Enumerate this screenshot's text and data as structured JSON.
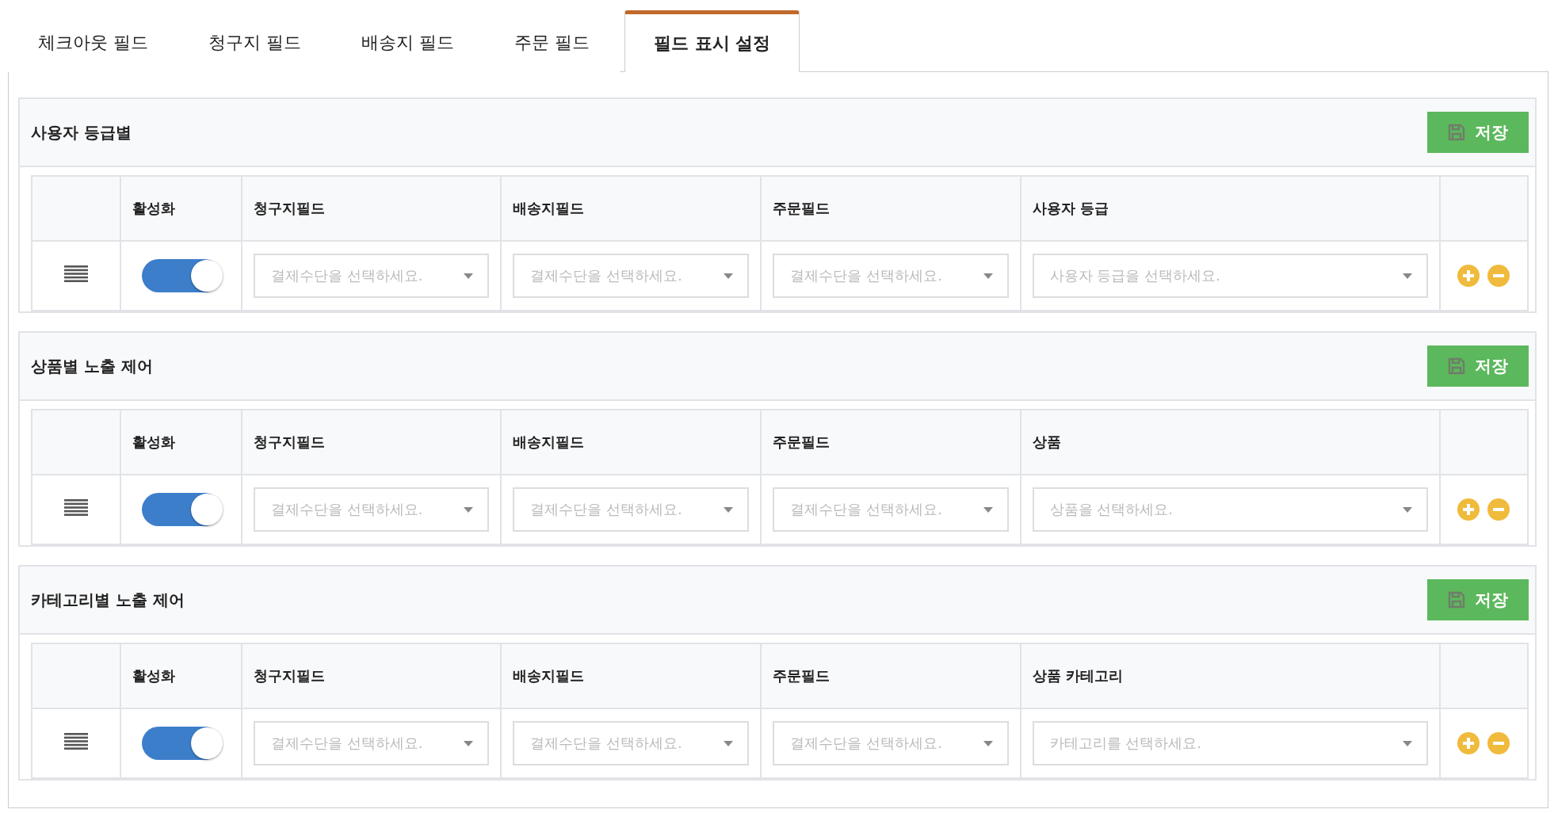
{
  "tabs": [
    {
      "label": "체크아웃 필드",
      "selected": false
    },
    {
      "label": "청구지 필드",
      "selected": false
    },
    {
      "label": "배송지 필드",
      "selected": false
    },
    {
      "label": "주문 필드",
      "selected": false
    },
    {
      "label": "필드 표시 설정",
      "selected": true
    }
  ],
  "sections": [
    {
      "title": "사용자 등급별",
      "save_button": "저장",
      "columns": [
        "활성화",
        "청구지필드",
        "배송지필드",
        "주문필드",
        "사용자 등급"
      ],
      "rows": [
        {
          "on": true,
          "selects": [
            "결제수단을 선택하세요.",
            "결제수단을 선택하세요.",
            "결제수단을 선택하세요.",
            "사용자 등급을 선택하세요."
          ]
        }
      ]
    },
    {
      "title": "상품별 노출 제어",
      "save_button": "저장",
      "columns": [
        "활성화",
        "청구지필드",
        "배송지필드",
        "주문필드",
        "상품"
      ],
      "rows": [
        {
          "on": true,
          "selects": [
            "결제수단을 선택하세요.",
            "결제수단을 선택하세요.",
            "결제수단을 선택하세요.",
            "상품을 선택하세요."
          ]
        }
      ]
    },
    {
      "title": "카테고리별 노출 제어",
      "save_button": "저장",
      "columns": [
        "활성화",
        "청구지필드",
        "배송지필드",
        "주문필드",
        "상품 카테고리"
      ],
      "rows": [
        {
          "on": true,
          "selects": [
            "결제수단을 선택하세요.",
            "결제수단을 선택하세요.",
            "결제수단을 선택하세요.",
            "카테고리를 선택하세요."
          ]
        }
      ]
    }
  ]
}
